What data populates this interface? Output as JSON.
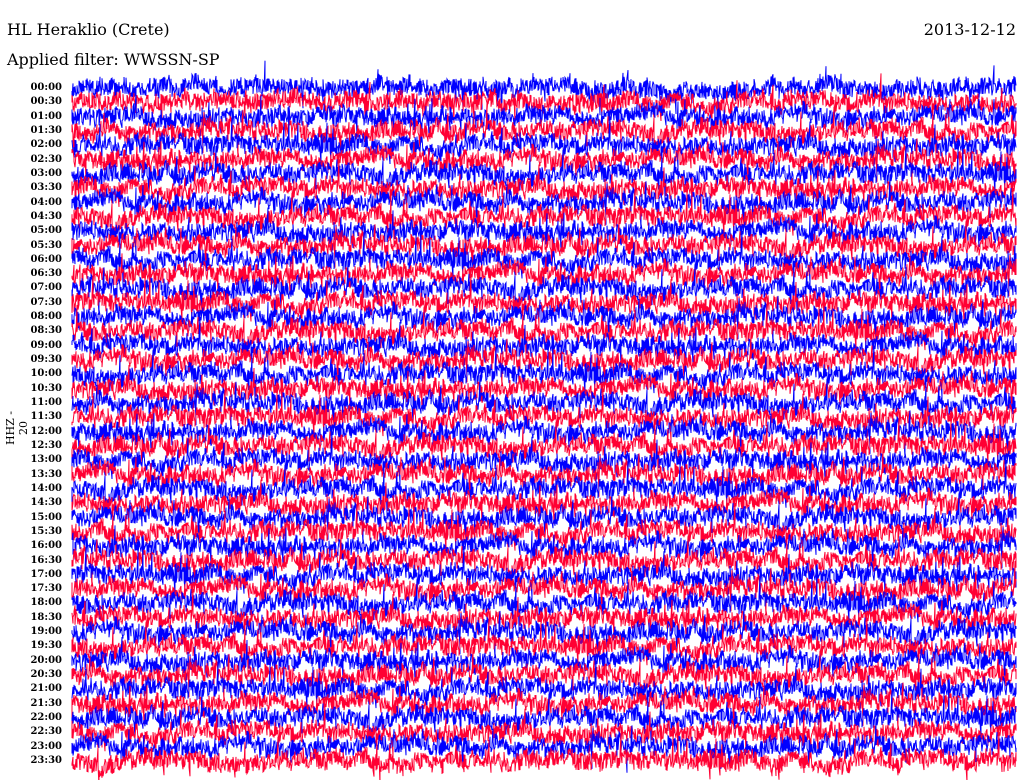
{
  "header": {
    "station": "HL Heraklio (Crete)",
    "date": "2013-12-12",
    "filter": "Applied filter: WWSSN-SP"
  },
  "chart_data": {
    "type": "line",
    "subtype": "helicorder",
    "title": "HL Heraklio (Crete)",
    "ylabel": "HHZ - 20",
    "row_labels": [
      "00:00",
      "00:30",
      "01:00",
      "01:30",
      "02:00",
      "02:30",
      "03:00",
      "03:30",
      "04:00",
      "04:30",
      "05:00",
      "05:30",
      "06:00",
      "06:30",
      "07:00",
      "07:30",
      "08:00",
      "08:30",
      "09:00",
      "09:30",
      "10:00",
      "10:30",
      "11:00",
      "11:30",
      "12:00",
      "12:30",
      "13:00",
      "13:30",
      "14:00",
      "14:30",
      "15:00",
      "15:30",
      "16:00",
      "16:30",
      "17:00",
      "17:30",
      "18:00",
      "18:30",
      "19:00",
      "19:30",
      "20:00",
      "20:30",
      "21:00",
      "21:30",
      "22:00",
      "22:30",
      "23:00",
      "23:30"
    ],
    "row_minutes": 30,
    "trace_colors": [
      "#0000ff",
      "#ff0033"
    ]
  }
}
